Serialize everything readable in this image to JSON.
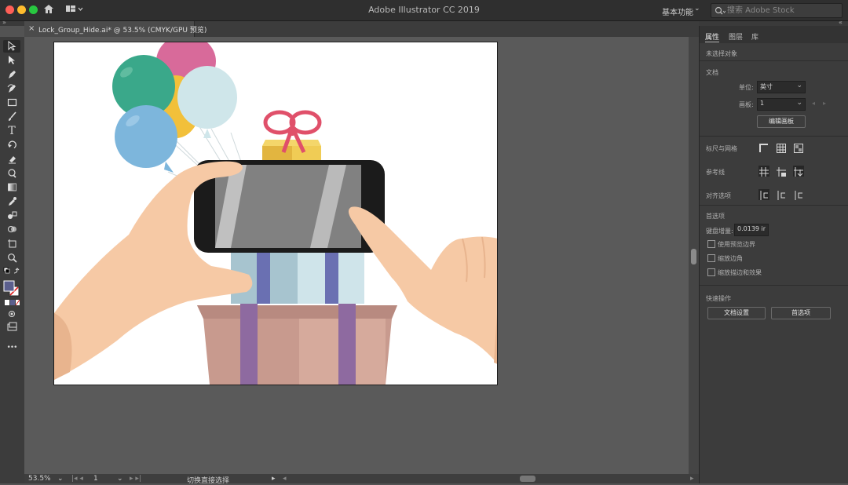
{
  "titlebar": {
    "app_title": "Adobe Illustrator CC 2019",
    "workspace": "基本功能",
    "stock_search_placeholder": "搜索 Adobe Stock",
    "traffic_lights": [
      "#ff5f57",
      "#febc2e",
      "#28c840"
    ]
  },
  "document_tab": {
    "close": "×",
    "label": "Lock_Group_Hide.ai* @ 53.5% (CMYK/GPU 预览)"
  },
  "toolbar": {
    "tools": [
      "selection-tool",
      "direct-selection-tool",
      "pen-tool",
      "curvature-tool",
      "rectangle-tool",
      "paintbrush-tool",
      "type-tool",
      "rotate-tool",
      "eraser-tool",
      "warp-tool",
      "gradient-tool",
      "eyedropper-tool",
      "blend-tool",
      "shape-builder-tool",
      "artboard-tool",
      "zoom-tool",
      "fill-stroke-swatches",
      "color-mode",
      "draw-mode",
      "screen-mode",
      "more-tools"
    ],
    "more_label": "•••"
  },
  "statusbar": {
    "zoom": "53.5%",
    "artboard_num": "1",
    "status_text": "切换直接选择"
  },
  "panel": {
    "tabs": [
      "属性",
      "图层",
      "库"
    ],
    "active_tab": "属性",
    "no_selection": "未选择对象",
    "document_section": "文档",
    "unit_label": "单位:",
    "unit_value": "英寸",
    "artboard_label": "画板:",
    "artboard_value": "1",
    "edit_artboard_button": "编辑画板",
    "rulers_grids_label": "标尺与网格",
    "guides_label": "参考线",
    "snap_label": "对齐选项",
    "preferences_section": "首选项",
    "keyboard_increment_label": "键盘增量:",
    "keyboard_increment_value": "0.0139 ir",
    "checkbox_preview_bounds": "使用预览边界",
    "checkbox_scale_corners": "缩放边角",
    "checkbox_scale_strokes": "缩放描边和效果",
    "quick_actions_section": "快速操作",
    "doc_setup_button": "文档设置",
    "preferences_button": "首选项"
  },
  "colors": {
    "app_bg": "#535353",
    "panel_bg": "#3c3c3c",
    "balloon_pink": "#d86a9a",
    "balloon_green": "#3aa88a",
    "balloon_yellow": "#f2c03a",
    "balloon_lightblue": "#cfe6ea",
    "balloon_blue": "#7db6dc",
    "skin": "#f6c9a5",
    "ribbon": "#e0506a",
    "box_brown": "#c89a8e",
    "ribbon_purple": "#8e6aa0"
  }
}
